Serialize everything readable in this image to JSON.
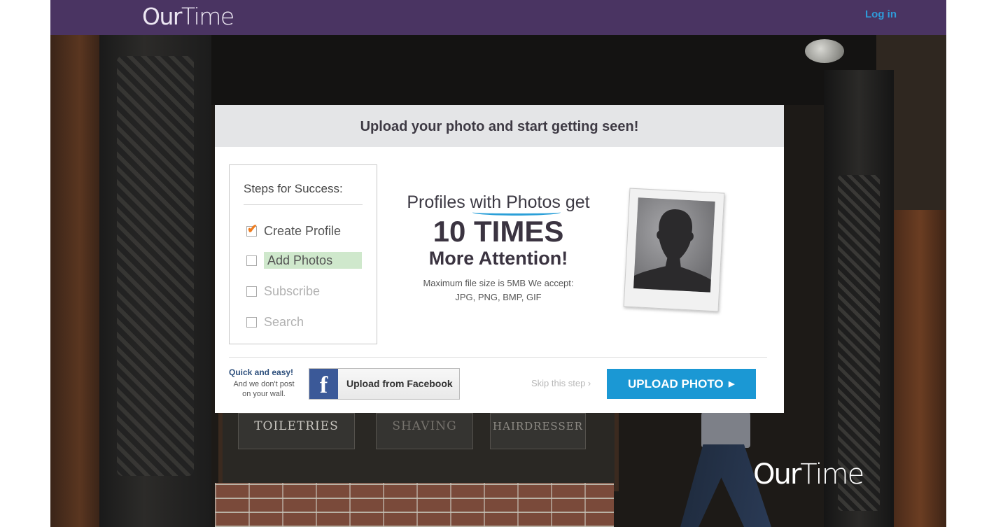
{
  "header": {
    "logo_our": "Our",
    "logo_time": "Time",
    "login_label": "Log in"
  },
  "background": {
    "signs": [
      "TOILETRIES",
      "SHAVING",
      "HAIRDRESSER"
    ],
    "watermark_our": "Our",
    "watermark_time": "Time"
  },
  "modal": {
    "title": "Upload your photo and start getting seen!",
    "steps": {
      "title": "Steps for Success:",
      "items": [
        {
          "label": "Create Profile",
          "state": "done"
        },
        {
          "label": "Add Photos",
          "state": "active"
        },
        {
          "label": "Subscribe",
          "state": "todo"
        },
        {
          "label": "Search",
          "state": "todo"
        }
      ]
    },
    "pitch": {
      "line1_pre": "Profiles ",
      "line1_hl": "with Photos",
      "line1_post": " get",
      "big": "10 TIMES",
      "mid": "More Attention!",
      "small1": "Maximum file size is 5MB We accept:",
      "small2": "JPG, PNG, BMP, GIF"
    },
    "footer": {
      "quick_title": "Quick and easy!",
      "quick_sub": "And we don't post on your wall.",
      "facebook_label": "Upload from Facebook",
      "facebook_icon": "f",
      "skip_label": "Skip this step ›",
      "upload_label": "UPLOAD PHOTO",
      "upload_arrow": "▶"
    }
  },
  "colors": {
    "topbar": "#4a3462",
    "accent_blue": "#1b98d4",
    "link_blue": "#2f9ad8",
    "check_orange": "#f07c1e",
    "active_step_bg": "#cfe8cc",
    "facebook_blue": "#3b5998"
  }
}
